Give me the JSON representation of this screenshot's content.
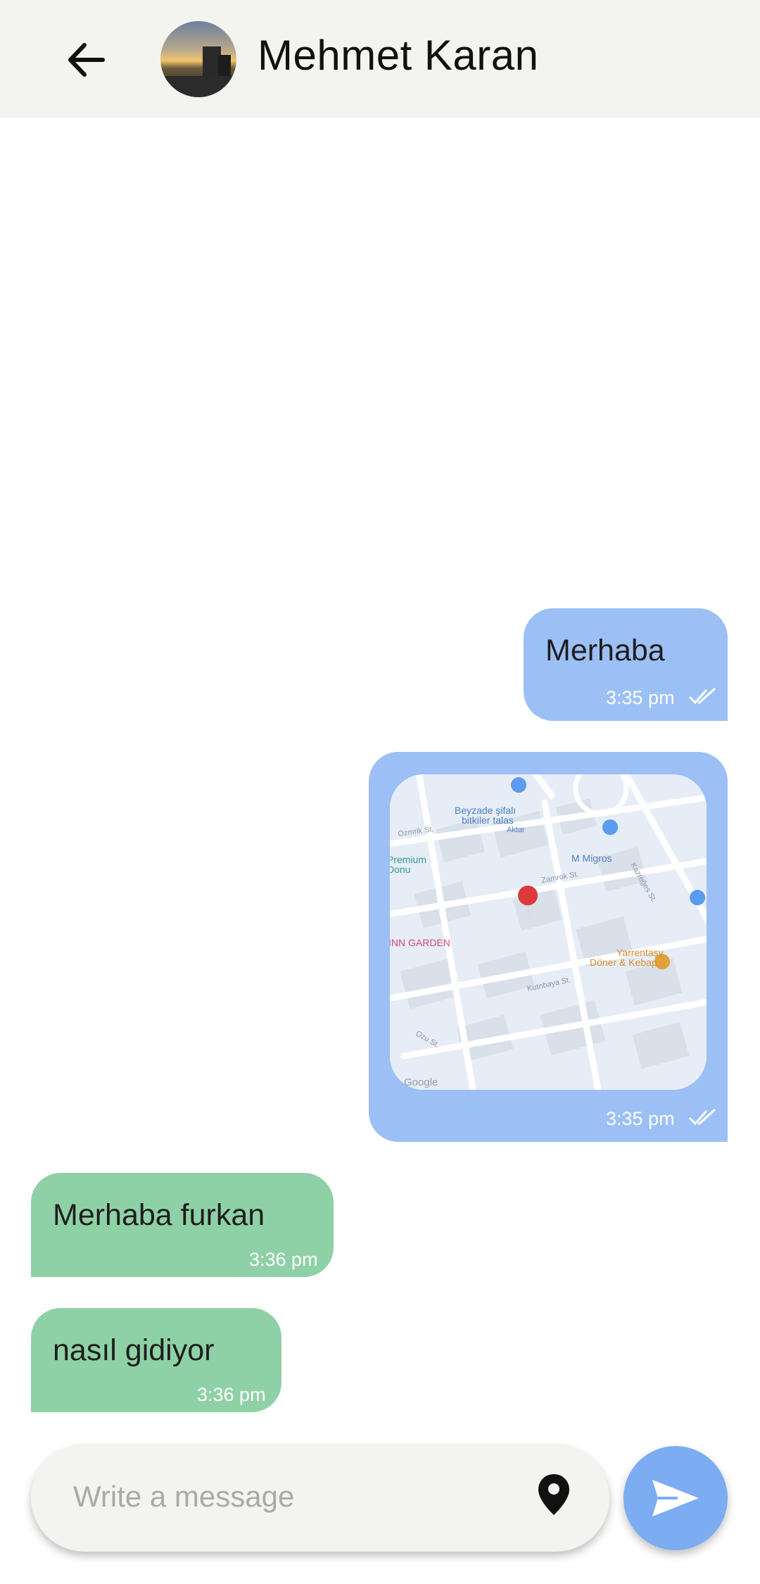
{
  "header": {
    "contact_name": "Mehmet Karan"
  },
  "messages": [
    {
      "direction": "outgoing",
      "text": "Merhaba",
      "time": "3:35 pm",
      "status": "read"
    },
    {
      "direction": "outgoing",
      "type": "location",
      "time": "3:35 pm",
      "status": "read",
      "map_labels": {
        "poi1": "Beyzade şifalı",
        "poi1b": "bitkiler talas",
        "poi1c": "Aktar",
        "street1": "Ozmrik St.",
        "poi2": "M Migros",
        "poi3": "Premium",
        "poi3b": "Donu",
        "street2": "Zamrok St.",
        "street3": "Kazreğes St.",
        "poi4": "INN GARDEN",
        "poi5": "Yarrentaşy",
        "poi5b": "Döner & Kebap",
        "street4": "Kutnbaya St.",
        "street5": "Ozu St.",
        "brand": "Google"
      }
    },
    {
      "direction": "incoming",
      "text": "Merhaba furkan",
      "time": "3:36 pm"
    },
    {
      "direction": "incoming",
      "text": "nasıl gidiyor",
      "time": "3:36 pm"
    }
  ],
  "composer": {
    "placeholder": "Write a message"
  },
  "colors": {
    "outgoing_bubble": "#9cc0f5",
    "incoming_bubble": "#8fd1a6",
    "send_button": "#7cacf1",
    "header_bg": "#f3f4ef"
  },
  "icons": {
    "back": "arrow-left-icon",
    "location": "map-pin-icon",
    "send": "send-icon",
    "read": "double-check-icon"
  }
}
